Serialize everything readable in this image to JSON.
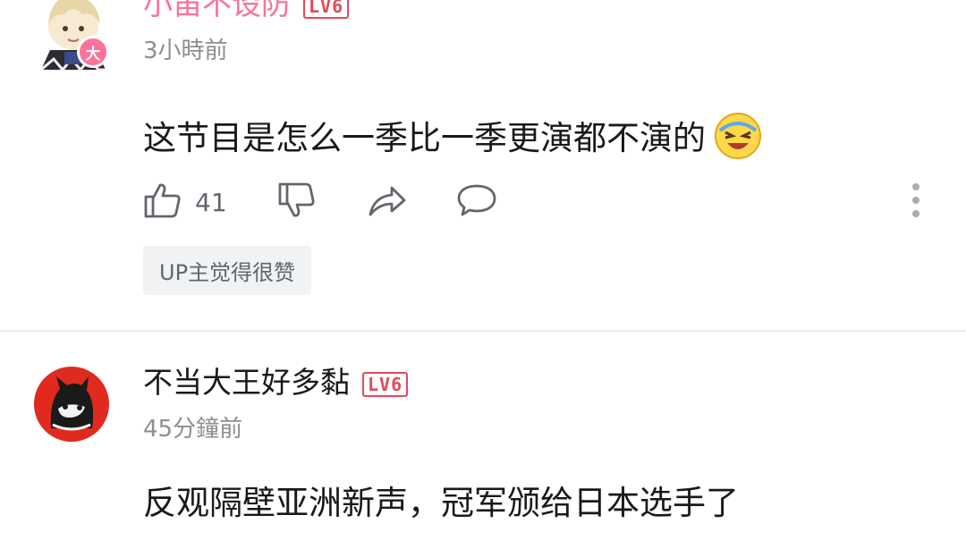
{
  "comments": [
    {
      "username": "小笛不设防",
      "username_color": "#fb7299",
      "level": "LV6",
      "timestamp": "3小時前",
      "content": "这节目是怎么一季比一季更演都不演的",
      "emoji_icon": "laughing-crying-emoji-icon",
      "avatar_badge": "大",
      "likes": "41",
      "up_tag": "UP主觉得很赞"
    },
    {
      "username": "不当大王好多黏",
      "username_color": "#18191c",
      "level": "LV6",
      "timestamp": "45分鐘前",
      "content": "反观隔壁亚洲新声，冠军颁给日本选手了"
    }
  ],
  "icons": {
    "like": "thumbs-up-icon",
    "dislike": "thumbs-down-icon",
    "share": "share-icon",
    "reply": "reply-icon",
    "more": "more-vertical-icon"
  },
  "colors": {
    "level_badge": "#e4495b",
    "icon_gray": "#61666d",
    "timestamp_gray": "#8e8e8e"
  }
}
